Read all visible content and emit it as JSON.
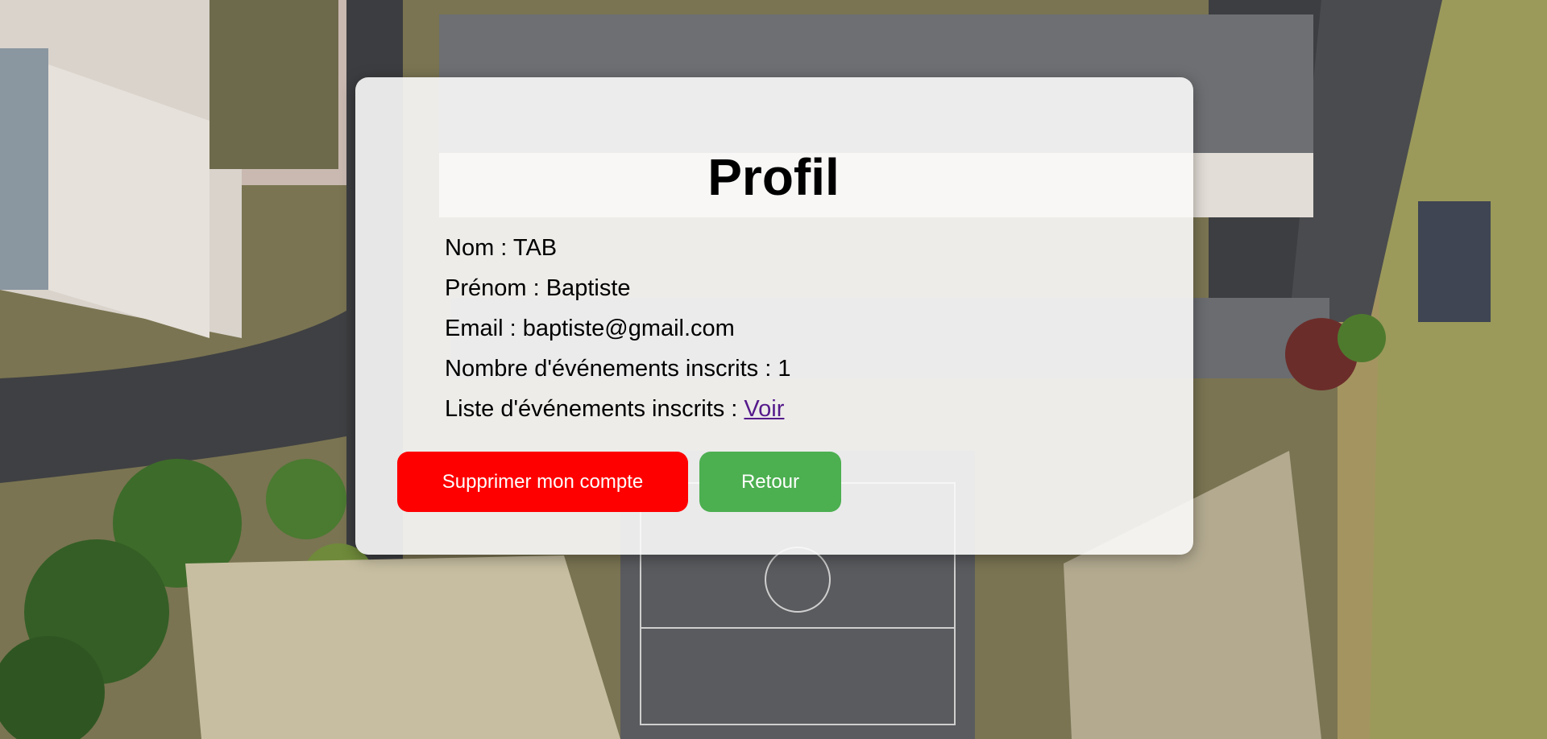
{
  "profile": {
    "title": "Profil",
    "fields": [
      {
        "label": "Nom : ",
        "value": "TAB"
      },
      {
        "label": "Prénom : ",
        "value": "Baptiste"
      },
      {
        "label": "Email : ",
        "value": "baptiste@gmail.com"
      },
      {
        "label": "Nombre d'événements inscrits : ",
        "value": "1"
      }
    ],
    "events_list": {
      "label": "Liste d'événements inscrits : ",
      "link_text": "Voir"
    }
  },
  "actions": {
    "delete_label": "Supprimer mon compte",
    "back_label": "Retour"
  },
  "colors": {
    "delete_button": "#ff0000",
    "back_button": "#4caf50",
    "link": "#551a8b"
  }
}
